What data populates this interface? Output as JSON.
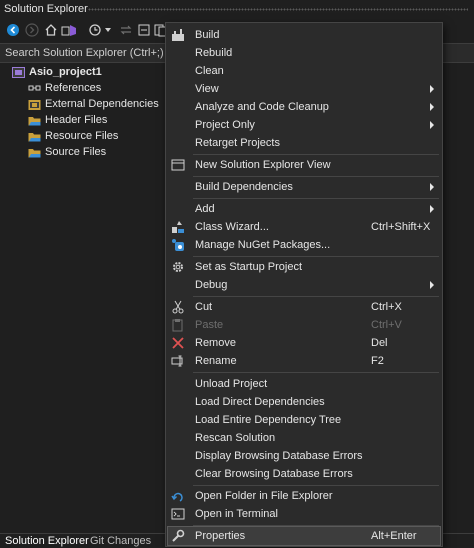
{
  "window": {
    "title": "Solution Explorer"
  },
  "search": {
    "placeholder": "Search Solution Explorer (Ctrl+;)"
  },
  "tree": {
    "project": "Asio_project1",
    "children": [
      {
        "label": "References",
        "icon": "references-icon"
      },
      {
        "label": "External Dependencies",
        "icon": "external-dependencies-icon"
      },
      {
        "label": "Header Files",
        "icon": "folder-icon"
      },
      {
        "label": "Resource Files",
        "icon": "folder-icon"
      },
      {
        "label": "Source Files",
        "icon": "folder-icon"
      }
    ]
  },
  "bottom_tabs": [
    "Solution Explorer",
    "Git Changes"
  ],
  "menu": {
    "items": [
      {
        "label": "Build",
        "shortcut": "",
        "icon": "build-icon"
      },
      {
        "label": "Rebuild",
        "shortcut": ""
      },
      {
        "label": "Clean",
        "shortcut": ""
      },
      {
        "label": "View",
        "shortcut": "",
        "submenu": true
      },
      {
        "label": "Analyze and Code Cleanup",
        "shortcut": "",
        "submenu": true
      },
      {
        "label": "Project Only",
        "shortcut": "",
        "submenu": true
      },
      {
        "label": "Retarget Projects",
        "shortcut": ""
      },
      {
        "label": "New Solution Explorer View",
        "shortcut": "",
        "icon": "new-view-icon"
      },
      {
        "label": "Build Dependencies",
        "shortcut": "",
        "submenu": true
      },
      {
        "label": "Add",
        "shortcut": "",
        "submenu": true
      },
      {
        "label": "Class Wizard...",
        "shortcut": "Ctrl+Shift+X",
        "icon": "class-wizard-icon"
      },
      {
        "label": "Manage NuGet Packages...",
        "shortcut": "",
        "icon": "nuget-icon"
      },
      {
        "label": "Set as Startup Project",
        "shortcut": "",
        "icon": "gear-icon"
      },
      {
        "label": "Debug",
        "shortcut": "",
        "submenu": true
      },
      {
        "label": "Cut",
        "shortcut": "Ctrl+X",
        "icon": "scissors-icon"
      },
      {
        "label": "Paste",
        "shortcut": "Ctrl+V",
        "icon": "paste-icon",
        "disabled": true
      },
      {
        "label": "Remove",
        "shortcut": "Del",
        "icon": "remove-icon"
      },
      {
        "label": "Rename",
        "shortcut": "F2",
        "icon": "rename-icon"
      },
      {
        "label": "Unload Project",
        "shortcut": ""
      },
      {
        "label": "Load Direct Dependencies",
        "shortcut": ""
      },
      {
        "label": "Load Entire Dependency Tree",
        "shortcut": ""
      },
      {
        "label": "Rescan Solution",
        "shortcut": ""
      },
      {
        "label": "Display Browsing Database Errors",
        "shortcut": ""
      },
      {
        "label": "Clear Browsing Database Errors",
        "shortcut": ""
      },
      {
        "label": "Open Folder in File Explorer",
        "shortcut": "",
        "icon": "open-folder-icon"
      },
      {
        "label": "Open in Terminal",
        "shortcut": "",
        "icon": "terminal-icon"
      },
      {
        "label": "Properties",
        "shortcut": "Alt+Enter",
        "icon": "wrench-icon",
        "highlighted": true
      }
    ]
  },
  "colors": {
    "accent": "#0e70c0",
    "background": "#1f1f1f",
    "menu_bg": "#2b2b2b"
  }
}
